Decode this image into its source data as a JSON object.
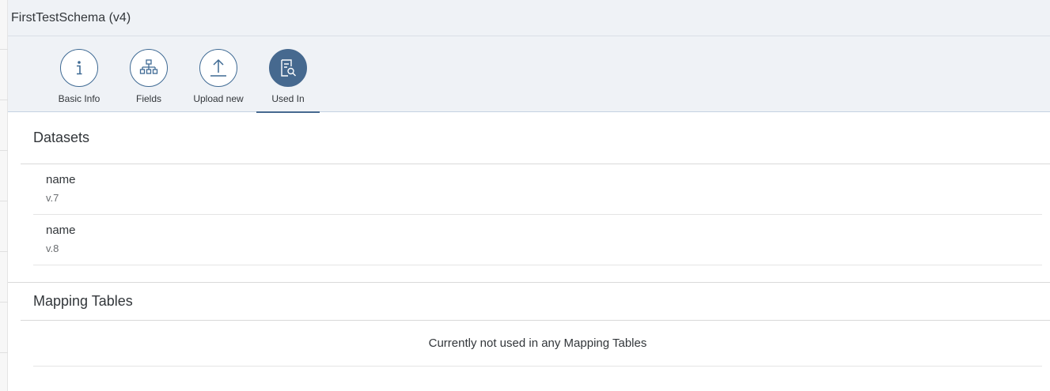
{
  "header": {
    "title": "FirstTestSchema (v4)"
  },
  "tabs": [
    {
      "label": "Basic Info",
      "icon": "info-icon",
      "selected": false
    },
    {
      "label": "Fields",
      "icon": "hierarchy-icon",
      "selected": false
    },
    {
      "label": "Upload new",
      "icon": "upload-icon",
      "selected": false
    },
    {
      "label": "Used In",
      "icon": "document-search-icon",
      "selected": true
    }
  ],
  "datasets": {
    "title": "Datasets",
    "items": [
      {
        "name": "name",
        "version": "v.7"
      },
      {
        "name": "name",
        "version": "v.8"
      }
    ]
  },
  "mapping_tables": {
    "title": "Mapping Tables",
    "no_data_text": "Currently not used in any Mapping Tables"
  },
  "colors": {
    "accent": "#46698f",
    "header_bg": "#eff2f6"
  }
}
